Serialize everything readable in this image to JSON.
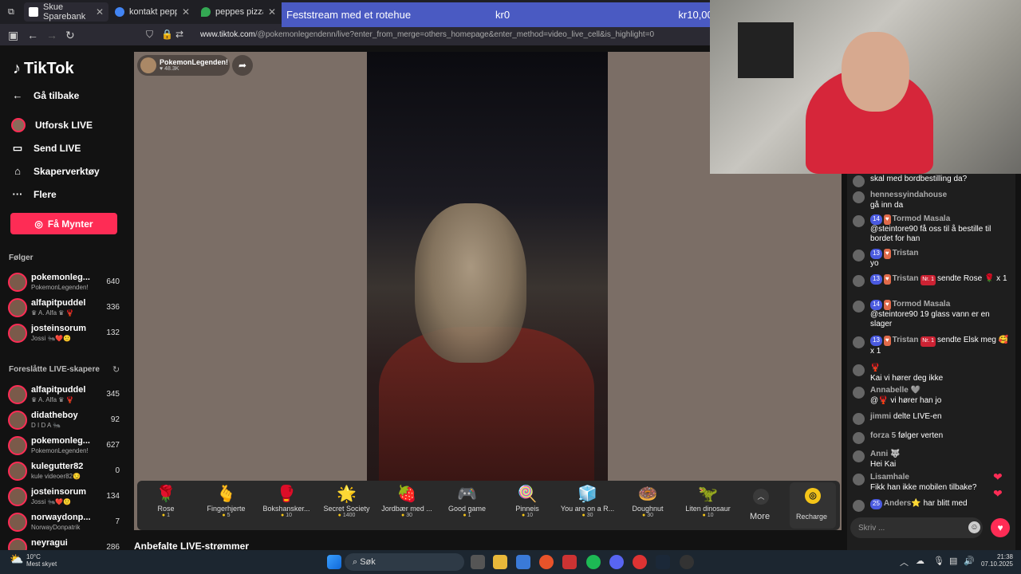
{
  "browser": {
    "tabs": [
      {
        "title": "Skue Sparebank"
      },
      {
        "title": "kontakt peppes bes"
      },
      {
        "title": "peppes pizza - Goo"
      }
    ],
    "url_domain": "www.tiktok.com",
    "url_path": "/@pokemonlegendenn/live?enter_from_merge=others_homepage&enter_method=video_live_cell&is_highlight=0"
  },
  "goal": {
    "title": "Feststream med et rotehue",
    "current": "kr0",
    "target": "kr10,000"
  },
  "sidebar": {
    "logo": "TikTok",
    "menu": [
      {
        "label": "Gå tilbake",
        "icon": "arrow-left-icon"
      },
      {
        "label": "Utforsk LIVE",
        "icon": "live-avatar-icon"
      },
      {
        "label": "Send LIVE",
        "icon": "camera-icon"
      },
      {
        "label": "Skaperverktøy",
        "icon": "creator-tools-icon"
      },
      {
        "label": "Flere",
        "icon": "more-dots-icon"
      }
    ],
    "coins_button": "Få Mynter",
    "following_title": "Følger",
    "following": [
      {
        "name": "pokemonleg...",
        "sub": "PokemonLegenden!",
        "count": "640"
      },
      {
        "name": "alfapitpuddel",
        "sub": "♛ A. Alfa ♛ 🦞",
        "count": "336"
      },
      {
        "name": "josteinsorum",
        "sub": "Jossi 🐜❤️🙂",
        "count": "132"
      }
    ],
    "suggested_title": "Foreslåtte LIVE-skapere",
    "suggested": [
      {
        "name": "alfapitpuddel",
        "sub": "♛ A. Alfa ♛ 🦞",
        "count": "345"
      },
      {
        "name": "didatheboy",
        "sub": "D I D A 🐜",
        "count": "92"
      },
      {
        "name": "pokemonleg...",
        "sub": "PokemonLegenden!",
        "count": "627"
      },
      {
        "name": "kulegutter82",
        "sub": "kule videoer82😏",
        "count": "0"
      },
      {
        "name": "josteinsorum",
        "sub": "Jossi 🐜❤️🙂",
        "count": "134"
      },
      {
        "name": "norwaydonp...",
        "sub": "NorwayDonpatrik",
        "count": "7"
      },
      {
        "name": "neyragui",
        "sub": "",
        "count": "286"
      }
    ]
  },
  "stream": {
    "creator": "PokemonLegenden!",
    "likes": "48.3K",
    "recommended": "Anbefalte LIVE-strømmer"
  },
  "gifts": [
    {
      "name": "Rose",
      "price": "1",
      "icon": "🌹"
    },
    {
      "name": "Fingerhjerte",
      "price": "5",
      "icon": "🫰"
    },
    {
      "name": "Bokshansker...",
      "price": "10",
      "icon": "🥊"
    },
    {
      "name": "Secret Society",
      "price": "1400",
      "icon": "🌟"
    },
    {
      "name": "Jordbær med ...",
      "price": "30",
      "icon": "🍓"
    },
    {
      "name": "Good game",
      "price": "1",
      "icon": "🎮"
    },
    {
      "name": "Pinneis",
      "price": "10",
      "icon": "🍭"
    },
    {
      "name": "You are on a R...",
      "price": "30",
      "icon": "🧊"
    },
    {
      "name": "Doughnut",
      "price": "30",
      "icon": "🍩"
    },
    {
      "name": "Liten dinosaur",
      "price": "10",
      "icon": "🦖"
    }
  ],
  "gift_more": "More",
  "recharge": "Recharge",
  "comments": [
    {
      "user": "",
      "text": "skal med bordbestilling da?",
      "level": "",
      "fan": "",
      "nr": ""
    },
    {
      "user": "hennessyindahouse",
      "text": "gå inn da",
      "level": "",
      "fan": "",
      "nr": ""
    },
    {
      "user": "Tormod Masala",
      "text": "@steintore90 få oss til å bestille til bordet for han",
      "level": "14",
      "fan": "♥",
      "nr": ""
    },
    {
      "user": "Tristan",
      "text": "yo",
      "level": "13",
      "fan": "♥",
      "nr": ""
    },
    {
      "user": "Tristan",
      "text": "sendte Rose 🌹 x 1",
      "level": "13",
      "fan": "♥",
      "nr": "Nr. 1"
    },
    {
      "user": "Tormod Masala",
      "text": "@steintore90 19 glass vann er en slager",
      "level": "14",
      "fan": "♥",
      "nr": ""
    },
    {
      "user": "Tristan",
      "text": "sendte Elsk meg 🥰 x 1",
      "level": "13",
      "fan": "♥",
      "nr": "Nr. 1"
    },
    {
      "user": "🦞",
      "text": "Kai vi hører deg ikke",
      "level": "",
      "fan": "",
      "nr": ""
    },
    {
      "user": "Annabelle 🩶",
      "text": "@🦞 vi hører han jo",
      "level": "",
      "fan": "",
      "nr": ""
    },
    {
      "user": "jimmi",
      "text": "delte LIVE-en",
      "level": "",
      "fan": "",
      "nr": ""
    },
    {
      "user": "forza 5",
      "text": "følger verten",
      "level": "",
      "fan": "",
      "nr": ""
    },
    {
      "user": "Anni 🐺",
      "text": "Hei Kai",
      "level": "",
      "fan": "",
      "nr": ""
    },
    {
      "user": "Lisamhale",
      "text": "Fikk han ikke mobilen tilbake?",
      "level": "",
      "fan": "",
      "nr": ""
    },
    {
      "user": "Anders⭐",
      "text": "har blitt med",
      "level": "25",
      "fan": "",
      "nr": ""
    }
  ],
  "chat_placeholder": "Skriv ...",
  "taskbar": {
    "weather_temp": "10°C",
    "weather_text": "Mest skyet",
    "search": "Søk",
    "time": "21:38",
    "date": "07.10.2025"
  }
}
